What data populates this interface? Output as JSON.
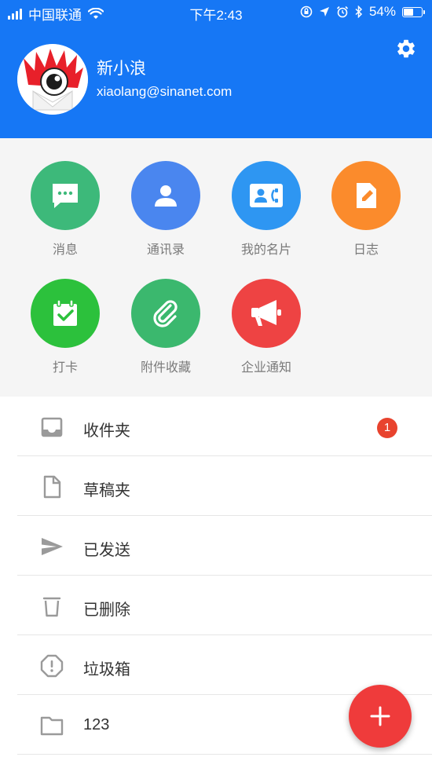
{
  "status_bar": {
    "carrier": "中国联通",
    "time": "下午2:43",
    "battery": "54%",
    "battery_level": 0.54
  },
  "profile": {
    "name": "新小浪",
    "email": "xiaolang@sinanet.com"
  },
  "colors": {
    "header_bg": "#1677f5",
    "badge": "#e8432e",
    "fab": "#ef3b3b"
  },
  "apps": [
    {
      "label": "消息",
      "icon": "message-icon",
      "color": "#3db97a"
    },
    {
      "label": "通讯录",
      "icon": "contacts-icon",
      "color": "#4a86ef"
    },
    {
      "label": "我的名片",
      "icon": "business-card-icon",
      "color": "#2e96f2"
    },
    {
      "label": "日志",
      "icon": "journal-icon",
      "color": "#fb8b2c"
    },
    {
      "label": "打卡",
      "icon": "check-in-icon",
      "color": "#2cc13c"
    },
    {
      "label": "附件收藏",
      "icon": "attachment-icon",
      "color": "#3bb86e"
    },
    {
      "label": "企业通知",
      "icon": "megaphone-icon",
      "color": "#ee4343"
    }
  ],
  "folders": [
    {
      "label": "收件夹",
      "icon": "inbox-icon",
      "badge": "1"
    },
    {
      "label": "草稿夹",
      "icon": "draft-icon"
    },
    {
      "label": "已发送",
      "icon": "sent-icon"
    },
    {
      "label": "已删除",
      "icon": "trash-icon"
    },
    {
      "label": "垃圾箱",
      "icon": "spam-icon"
    },
    {
      "label": "123",
      "icon": "folder-icon"
    }
  ],
  "fab": {
    "icon": "plus-icon"
  }
}
